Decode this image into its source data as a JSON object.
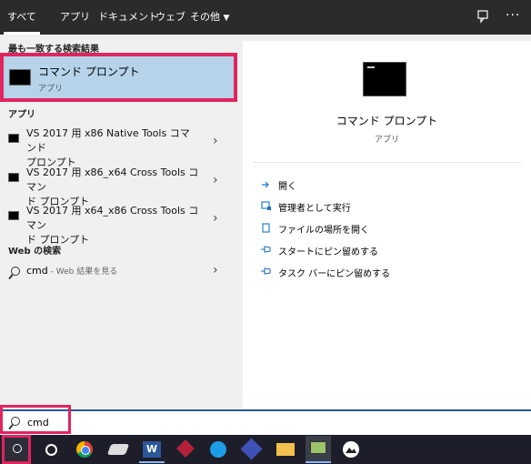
{
  "tabs": [
    {
      "label": "すべて",
      "active": true
    },
    {
      "label": "アプリ",
      "active": false
    },
    {
      "label": "ドキュメント",
      "active": false
    },
    {
      "label": "ウェブ",
      "active": false
    },
    {
      "label": "その他",
      "active": false
    }
  ],
  "header": {
    "feedback_icon": "feedback-icon",
    "more_label": "···"
  },
  "best_match": {
    "section": "最も一致する検索結果",
    "title": "コマンド プロンプト",
    "subtitle": "アプリ"
  },
  "apps": {
    "section": "アプリ",
    "items": [
      {
        "line1": "VS 2017 用 x86 Native Tools コマンド",
        "line2": "プロンプト"
      },
      {
        "line1": "VS 2017 用 x86_x64 Cross Tools コマン",
        "line2": "ド プロンプト"
      },
      {
        "line1": "VS 2017 用 x64_x86 Cross Tools コマン",
        "line2": "ド プロンプト"
      }
    ]
  },
  "web": {
    "section": "Web の検索",
    "query": "cmd",
    "sub": " - Web 結果を見る"
  },
  "detail": {
    "title": "コマンド プロンプト",
    "subtitle": "アプリ",
    "actions": [
      {
        "label": "開く",
        "icon": "open-icon"
      },
      {
        "label": "管理者として実行",
        "icon": "shield-icon"
      },
      {
        "label": "ファイルの場所を開く",
        "icon": "file-location-icon"
      },
      {
        "label": "スタートにピン留めする",
        "icon": "pin-icon"
      },
      {
        "label": "タスク バーにピン留めする",
        "icon": "pin-icon"
      }
    ]
  },
  "search": {
    "value": "cmd"
  },
  "taskbar": {
    "items": [
      "search-icon",
      "cortana-icon",
      "chrome-icon",
      "app-icon",
      "word-icon",
      "app-icon",
      "app-icon",
      "app-icon",
      "file-explorer-icon",
      "app-icon",
      "app-icon"
    ],
    "word_label": "W"
  }
}
